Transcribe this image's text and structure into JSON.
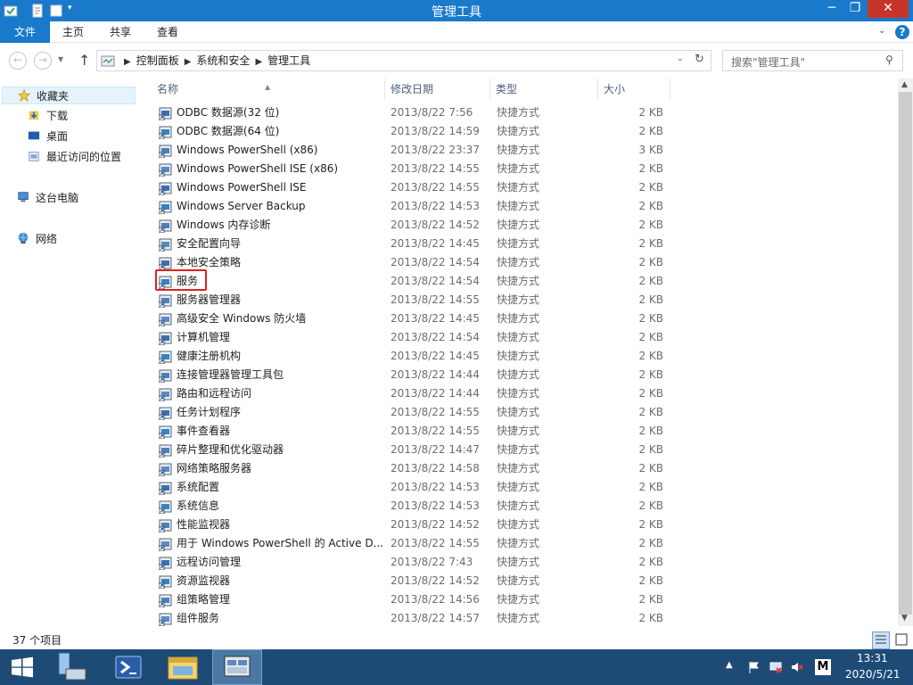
{
  "window": {
    "title": "管理工具"
  },
  "ribbon": {
    "tabs": [
      {
        "label": "文件"
      },
      {
        "label": "主页"
      },
      {
        "label": "共享"
      },
      {
        "label": "查看"
      }
    ]
  },
  "address": {
    "crumbs": [
      "控制面板",
      "系统和安全",
      "管理工具"
    ]
  },
  "search": {
    "placeholder": "搜索\"管理工具\""
  },
  "navpane": {
    "favorites": "收藏夹",
    "favorites_items": [
      "下载",
      "桌面",
      "最近访问的位置"
    ],
    "this_pc": "这台电脑",
    "network": "网络"
  },
  "columns": {
    "name": "名称",
    "date": "修改日期",
    "type": "类型",
    "size": "大小"
  },
  "files": [
    {
      "name": "ODBC 数据源(32 位)",
      "date": "2013/8/22 7:56",
      "type": "快捷方式",
      "size": "2 KB"
    },
    {
      "name": "ODBC 数据源(64 位)",
      "date": "2013/8/22 14:59",
      "type": "快捷方式",
      "size": "2 KB"
    },
    {
      "name": "Windows PowerShell (x86)",
      "date": "2013/8/22 23:37",
      "type": "快捷方式",
      "size": "3 KB"
    },
    {
      "name": "Windows PowerShell ISE (x86)",
      "date": "2013/8/22 14:55",
      "type": "快捷方式",
      "size": "2 KB"
    },
    {
      "name": "Windows PowerShell ISE",
      "date": "2013/8/22 14:55",
      "type": "快捷方式",
      "size": "2 KB"
    },
    {
      "name": "Windows Server Backup",
      "date": "2013/8/22 14:53",
      "type": "快捷方式",
      "size": "2 KB"
    },
    {
      "name": "Windows 内存诊断",
      "date": "2013/8/22 14:52",
      "type": "快捷方式",
      "size": "2 KB"
    },
    {
      "name": "安全配置向导",
      "date": "2013/8/22 14:45",
      "type": "快捷方式",
      "size": "2 KB"
    },
    {
      "name": "本地安全策略",
      "date": "2013/8/22 14:54",
      "type": "快捷方式",
      "size": "2 KB"
    },
    {
      "name": "服务",
      "date": "2013/8/22 14:54",
      "type": "快捷方式",
      "size": "2 KB"
    },
    {
      "name": "服务器管理器",
      "date": "2013/8/22 14:55",
      "type": "快捷方式",
      "size": "2 KB"
    },
    {
      "name": "高级安全 Windows 防火墙",
      "date": "2013/8/22 14:45",
      "type": "快捷方式",
      "size": "2 KB"
    },
    {
      "name": "计算机管理",
      "date": "2013/8/22 14:54",
      "type": "快捷方式",
      "size": "2 KB"
    },
    {
      "name": "健康注册机构",
      "date": "2013/8/22 14:45",
      "type": "快捷方式",
      "size": "2 KB"
    },
    {
      "name": "连接管理器管理工具包",
      "date": "2013/8/22 14:44",
      "type": "快捷方式",
      "size": "2 KB"
    },
    {
      "name": "路由和远程访问",
      "date": "2013/8/22 14:44",
      "type": "快捷方式",
      "size": "2 KB"
    },
    {
      "name": "任务计划程序",
      "date": "2013/8/22 14:55",
      "type": "快捷方式",
      "size": "2 KB"
    },
    {
      "name": "事件查看器",
      "date": "2013/8/22 14:55",
      "type": "快捷方式",
      "size": "2 KB"
    },
    {
      "name": "碎片整理和优化驱动器",
      "date": "2013/8/22 14:47",
      "type": "快捷方式",
      "size": "2 KB"
    },
    {
      "name": "网络策略服务器",
      "date": "2013/8/22 14:58",
      "type": "快捷方式",
      "size": "2 KB"
    },
    {
      "name": "系统配置",
      "date": "2013/8/22 14:53",
      "type": "快捷方式",
      "size": "2 KB"
    },
    {
      "name": "系统信息",
      "date": "2013/8/22 14:53",
      "type": "快捷方式",
      "size": "2 KB"
    },
    {
      "name": "性能监视器",
      "date": "2013/8/22 14:52",
      "type": "快捷方式",
      "size": "2 KB"
    },
    {
      "name": "用于 Windows PowerShell 的 Active D...",
      "date": "2013/8/22 14:55",
      "type": "快捷方式",
      "size": "2 KB"
    },
    {
      "name": "远程访问管理",
      "date": "2013/8/22 7:43",
      "type": "快捷方式",
      "size": "2 KB"
    },
    {
      "name": "资源监视器",
      "date": "2013/8/22 14:52",
      "type": "快捷方式",
      "size": "2 KB"
    },
    {
      "name": "组策略管理",
      "date": "2013/8/22 14:56",
      "type": "快捷方式",
      "size": "2 KB"
    },
    {
      "name": "组件服务",
      "date": "2013/8/22 14:57",
      "type": "快捷方式",
      "size": "2 KB"
    }
  ],
  "highlighted_file": "服务",
  "status": {
    "count": "37 个项目"
  },
  "taskbar": {
    "time": "13:31",
    "date": "2020/5/21"
  },
  "colors": {
    "accent": "#1979ca",
    "taskbar": "#1d4b76",
    "highlight": "#e02020"
  }
}
